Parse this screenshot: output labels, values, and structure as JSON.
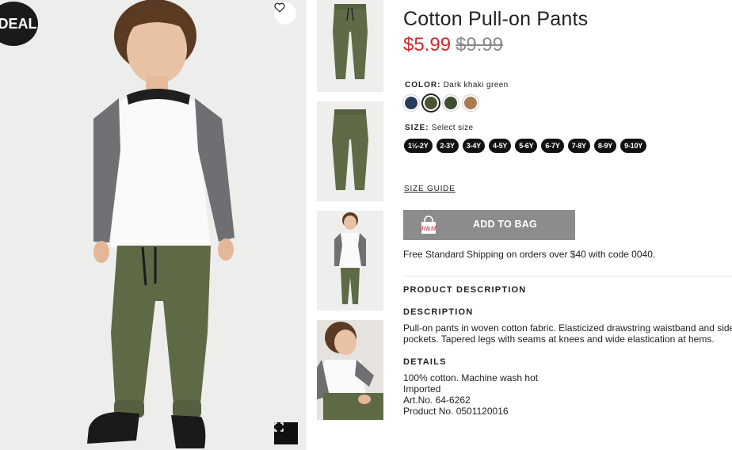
{
  "product": {
    "title": "Cotton Pull-on Pants",
    "price_sale": "$5.99",
    "price_original": "$9.99"
  },
  "badge": {
    "label": "DEAL"
  },
  "color": {
    "label": "COLOR:",
    "selected_name": "Dark khaki green",
    "swatches": [
      "#273a5c",
      "#4a5536",
      "#3f4d33",
      "#a87a4f"
    ],
    "selected_index": 1
  },
  "size": {
    "label": "SIZE:",
    "placeholder": "Select size",
    "options": [
      "1½-2Y",
      "2-3Y",
      "3-4Y",
      "4-5Y",
      "5-6Y",
      "6-7Y",
      "7-8Y",
      "8-9Y",
      "9-10Y"
    ]
  },
  "size_guide": "SIZE GUIDE",
  "add_to_bag": {
    "label": "ADD TO BAG",
    "icon": "shopping-bag-icon",
    "icon_text": "H&M"
  },
  "shipping_note": "Free Standard Shipping on orders over $40 with code 0040.",
  "product_description": {
    "heading": "PRODUCT DESCRIPTION",
    "description_heading": "DESCRIPTION",
    "description_lines": [
      "Pull-on pants in woven cotton fabric. Elasticized drawstring waistband and side",
      "pockets. Tapered legs with seams at knees and wide elastication at hems."
    ],
    "details_heading": "DETAILS",
    "details": [
      "100% cotton. Machine wash hot",
      "Imported",
      "Art.No. 64-6262",
      "Product No. 0501120016"
    ]
  },
  "icons": {
    "favorite": "heart-icon",
    "fullscreen": "expand-icon"
  },
  "colors": {
    "sale_price": "#d6262d",
    "button_bg": "#8c8c8c",
    "pants": "#5e6a45"
  }
}
